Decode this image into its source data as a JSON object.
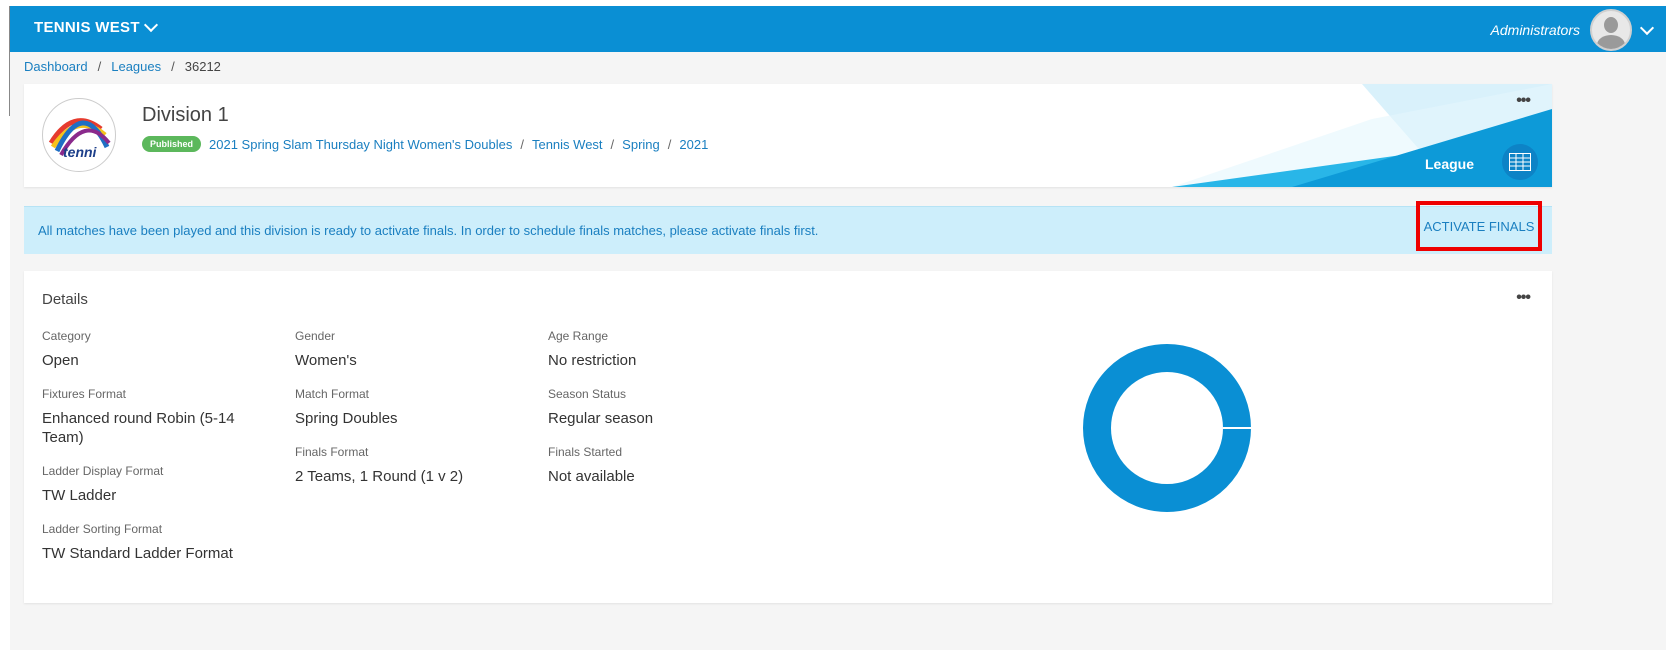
{
  "topbar": {
    "brand": "TENNIS WEST",
    "user": "Administrators",
    "accent": "#0a8fd4"
  },
  "breadcrumb": {
    "items": [
      "Dashboard",
      "Leagues"
    ],
    "current": "36212"
  },
  "header": {
    "title": "Division 1",
    "status": "Published",
    "path": [
      "2021 Spring Slam Thursday Night Women's Doubles",
      "Tennis West",
      "Spring",
      "2021"
    ],
    "type_label": "League",
    "logo_text": "tenni"
  },
  "alert": {
    "text": "All matches have been played and this division is ready to activate finals. In order to schedule finals matches, please activate finals first.",
    "action": "ACTIVATE FINALS"
  },
  "details": {
    "title": "Details",
    "fields": [
      {
        "label": "Category",
        "value": "Open"
      },
      {
        "label": "Fixtures Format",
        "value": "Enhanced round Robin (5-14 Team)"
      },
      {
        "label": "Ladder Display Format",
        "value": "TW Ladder"
      },
      {
        "label": "Ladder Sorting Format",
        "value": "TW Standard Ladder Format"
      },
      {
        "label": "Gender",
        "value": "Women's"
      },
      {
        "label": "Match Format",
        "value": "Spring Doubles"
      },
      {
        "label": "Finals Format",
        "value": "2 Teams, 1 Round (1 v 2)"
      },
      {
        "label": "Age Range",
        "value": "No restriction"
      },
      {
        "label": "Season Status",
        "value": "Regular season"
      },
      {
        "label": "Finals Started",
        "value": "Not available"
      }
    ]
  },
  "more_icon": "more-horizontal-icon"
}
